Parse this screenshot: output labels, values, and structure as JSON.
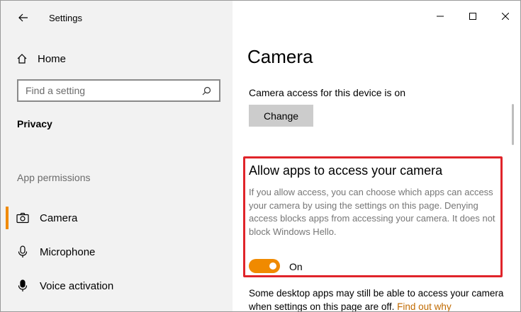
{
  "window": {
    "title": "Settings"
  },
  "sidebar": {
    "home_label": "Home",
    "search_placeholder": "Find a setting",
    "section_title": "Privacy",
    "group_title": "App permissions",
    "items": [
      {
        "label": "Camera",
        "icon": "camera-icon",
        "active": true
      },
      {
        "label": "Microphone",
        "icon": "microphone-icon",
        "active": false
      },
      {
        "label": "Voice activation",
        "icon": "voice-activation-icon",
        "active": false
      }
    ]
  },
  "main": {
    "title": "Camera",
    "access_status": "Camera access for this device is on",
    "change_label": "Change",
    "allow_heading": "Allow apps to access your camera",
    "allow_description": "If you allow access, you can choose which apps can access your camera by using the settings on this page. Denying access blocks apps from accessing your camera. It does not block Windows Hello.",
    "toggle_state": "On",
    "desktop_note": "Some desktop apps may still be able to access your camera when settings on this page are off.",
    "find_out_link": "Find out why"
  },
  "colors": {
    "accent": "#f08a00",
    "highlight_border": "#e0242a",
    "sidebar_bg": "#f2f2f2",
    "button_bg": "#cccccc"
  }
}
